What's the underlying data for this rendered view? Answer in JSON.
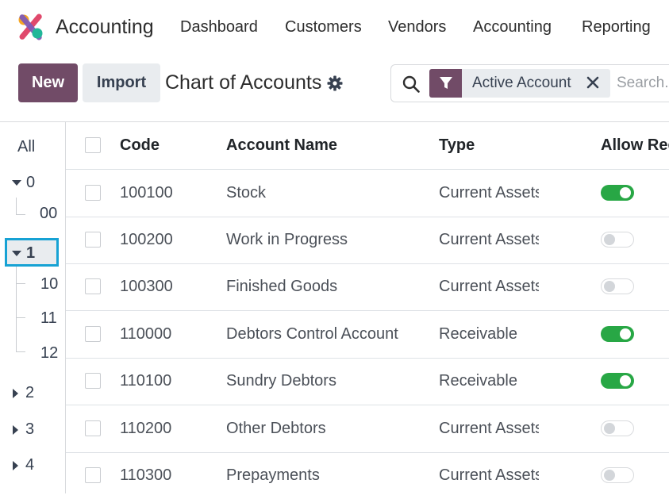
{
  "app": {
    "name": "Accounting"
  },
  "nav": {
    "items": [
      "Dashboard",
      "Customers",
      "Vendors",
      "Accounting",
      "Reporting"
    ]
  },
  "toolbar": {
    "new_label": "New",
    "import_label": "Import",
    "page_title": "Chart of Accounts"
  },
  "search": {
    "facet_label": "Active Account",
    "placeholder": "Search..."
  },
  "tree": {
    "all_label": "All",
    "nodes": [
      {
        "label": "0",
        "expanded": true,
        "children": [
          "00"
        ]
      },
      {
        "label": "1",
        "expanded": true,
        "selected": true,
        "children": [
          "10",
          "11",
          "12"
        ]
      },
      {
        "label": "2",
        "expanded": false
      },
      {
        "label": "3",
        "expanded": false
      },
      {
        "label": "4",
        "expanded": false
      }
    ]
  },
  "table": {
    "headers": {
      "code": "Code",
      "name": "Account Name",
      "type": "Type",
      "allow": "Allow Reconciliation"
    },
    "rows": [
      {
        "code": "100100",
        "name": "Stock",
        "type": "Current Assets",
        "allow": true
      },
      {
        "code": "100200",
        "name": "Work in Progress",
        "type": "Current Assets",
        "allow": false
      },
      {
        "code": "100300",
        "name": "Finished Goods",
        "type": "Current Assets",
        "allow": false
      },
      {
        "code": "110000",
        "name": "Debtors Control Account",
        "type": "Receivable",
        "allow": true
      },
      {
        "code": "110100",
        "name": "Sundry Debtors",
        "type": "Receivable",
        "allow": true
      },
      {
        "code": "110200",
        "name": "Other Debtors",
        "type": "Current Assets",
        "allow": false
      },
      {
        "code": "110300",
        "name": "Prepayments",
        "type": "Current Assets",
        "allow": false
      }
    ]
  },
  "colors": {
    "brand": "#714b67",
    "toggle_on": "#28a745",
    "selection_outline": "#17a2d4"
  }
}
